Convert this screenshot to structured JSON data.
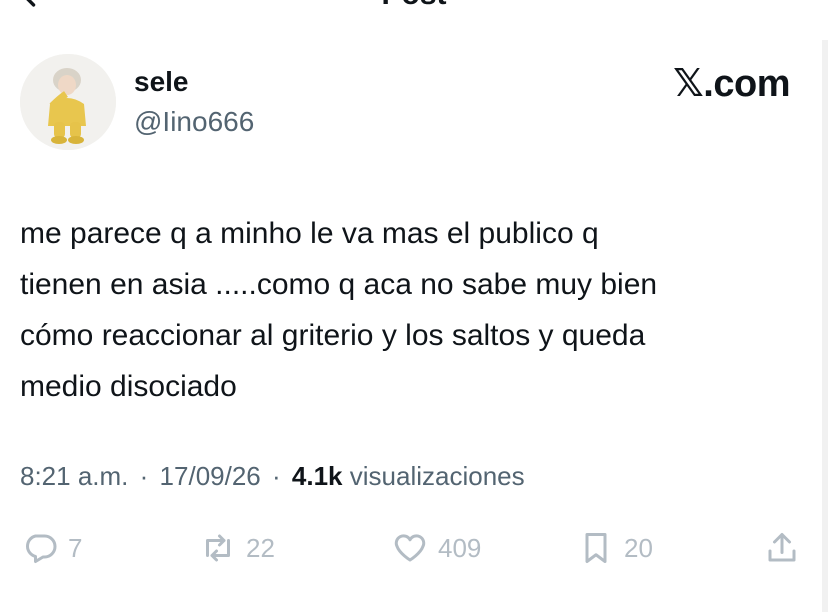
{
  "header": {
    "title": "Post"
  },
  "author": {
    "display_name": "sele",
    "handle": "@Iino666"
  },
  "brand": {
    "label": ".com"
  },
  "post": {
    "text": "me parece q a minho le va mas el publico q\ntienen en asia .....como q aca no sabe muy bien\ncómo reaccionar al griterio y los saltos y queda\nmedio disociado"
  },
  "meta": {
    "time": "8:21 a.m.",
    "date": "17/09/26",
    "views_count": "4.1k",
    "views_label": "visualizaciones",
    "separator": "·"
  },
  "actions": {
    "replies": "7",
    "reposts": "22",
    "likes": "409",
    "bookmarks": "20"
  },
  "icons": {
    "back": "arrow-left-icon",
    "reply": "reply-icon",
    "repost": "repost-icon",
    "like": "heart-icon",
    "bookmark": "bookmark-icon",
    "share": "share-icon"
  },
  "colors": {
    "text": "#0f1419",
    "secondary": "#536471",
    "action_muted": "#b3bcc4"
  }
}
